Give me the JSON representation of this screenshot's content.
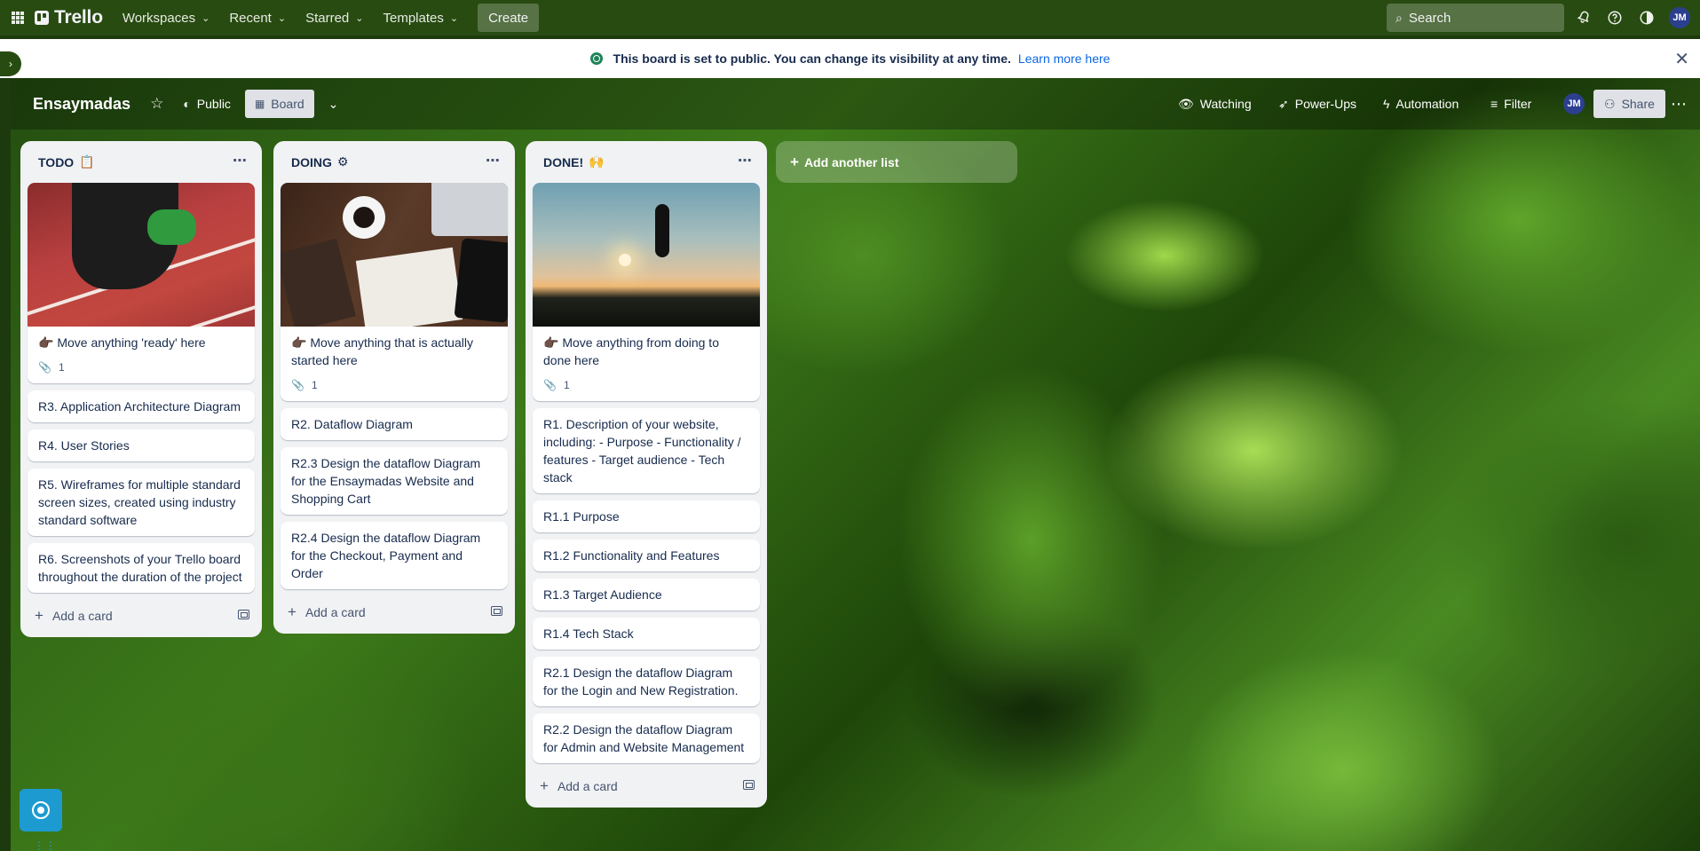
{
  "header": {
    "logo": "Trello",
    "nav": [
      {
        "label": "Workspaces"
      },
      {
        "label": "Recent"
      },
      {
        "label": "Starred"
      },
      {
        "label": "Templates"
      }
    ],
    "create_label": "Create",
    "search_placeholder": "Search",
    "avatar_initials": "JM"
  },
  "banner": {
    "message": "This board is set to public. You can change its visibility at any time.",
    "link": "Learn more here"
  },
  "board": {
    "title": "Ensaymadas",
    "visibility": "Public",
    "view": "Board",
    "watching": "Watching",
    "powerups": "Power-Ups",
    "automation": "Automation",
    "filter": "Filter",
    "member_initials": "JM",
    "share": "Share"
  },
  "lists": [
    {
      "title": "TODO",
      "emoji": "📋",
      "cover_card": {
        "text": "👉🏿 Move anything 'ready' here",
        "attachments": "1"
      },
      "cards": [
        {
          "text": "R3. Application Architecture Diagram"
        },
        {
          "text": "R4. User Stories"
        },
        {
          "text": "R5. Wireframes for multiple standard screen sizes, created using industry standard software"
        },
        {
          "text": "R6. Screenshots of your Trello board throughout the duration of the project"
        }
      ],
      "add_card": "Add a card"
    },
    {
      "title": "DOING",
      "emoji": "⚙",
      "cover_card": {
        "text": "👉🏿 Move anything that is actually started here",
        "attachments": "1"
      },
      "cards": [
        {
          "text": "R2. Dataflow Diagram"
        },
        {
          "text": "R2.3 Design the dataflow Diagram for the Ensaymadas Website and Shopping Cart"
        },
        {
          "text": "R2.4 Design the dataflow Diagram for the Checkout, Payment and Order"
        }
      ],
      "add_card": "Add a card"
    },
    {
      "title": "DONE!",
      "emoji": "🙌",
      "cover_card": {
        "text": "👉🏿 Move anything from doing to done here",
        "attachments": "1"
      },
      "cards": [
        {
          "text": "R1. Description of your website, including: - Purpose - Functionality / features - Target audience - Tech stack"
        },
        {
          "text": "R1.1 Purpose"
        },
        {
          "text": "R1.2 Functionality and Features"
        },
        {
          "text": "R1.3 Target Audience"
        },
        {
          "text": "R1.4 Tech Stack"
        },
        {
          "text": "R2.1 Design the dataflow Diagram for the Login and New Registration."
        },
        {
          "text": "R2.2 Design the dataflow Diagram for Admin and Website Management"
        }
      ],
      "add_card": "Add a card"
    }
  ],
  "add_list": "Add another list",
  "icons": {
    "apps": "apps-grid-icon",
    "notifications": "bell-icon",
    "help": "help-icon",
    "theme": "contrast-icon",
    "close": "close-icon"
  }
}
